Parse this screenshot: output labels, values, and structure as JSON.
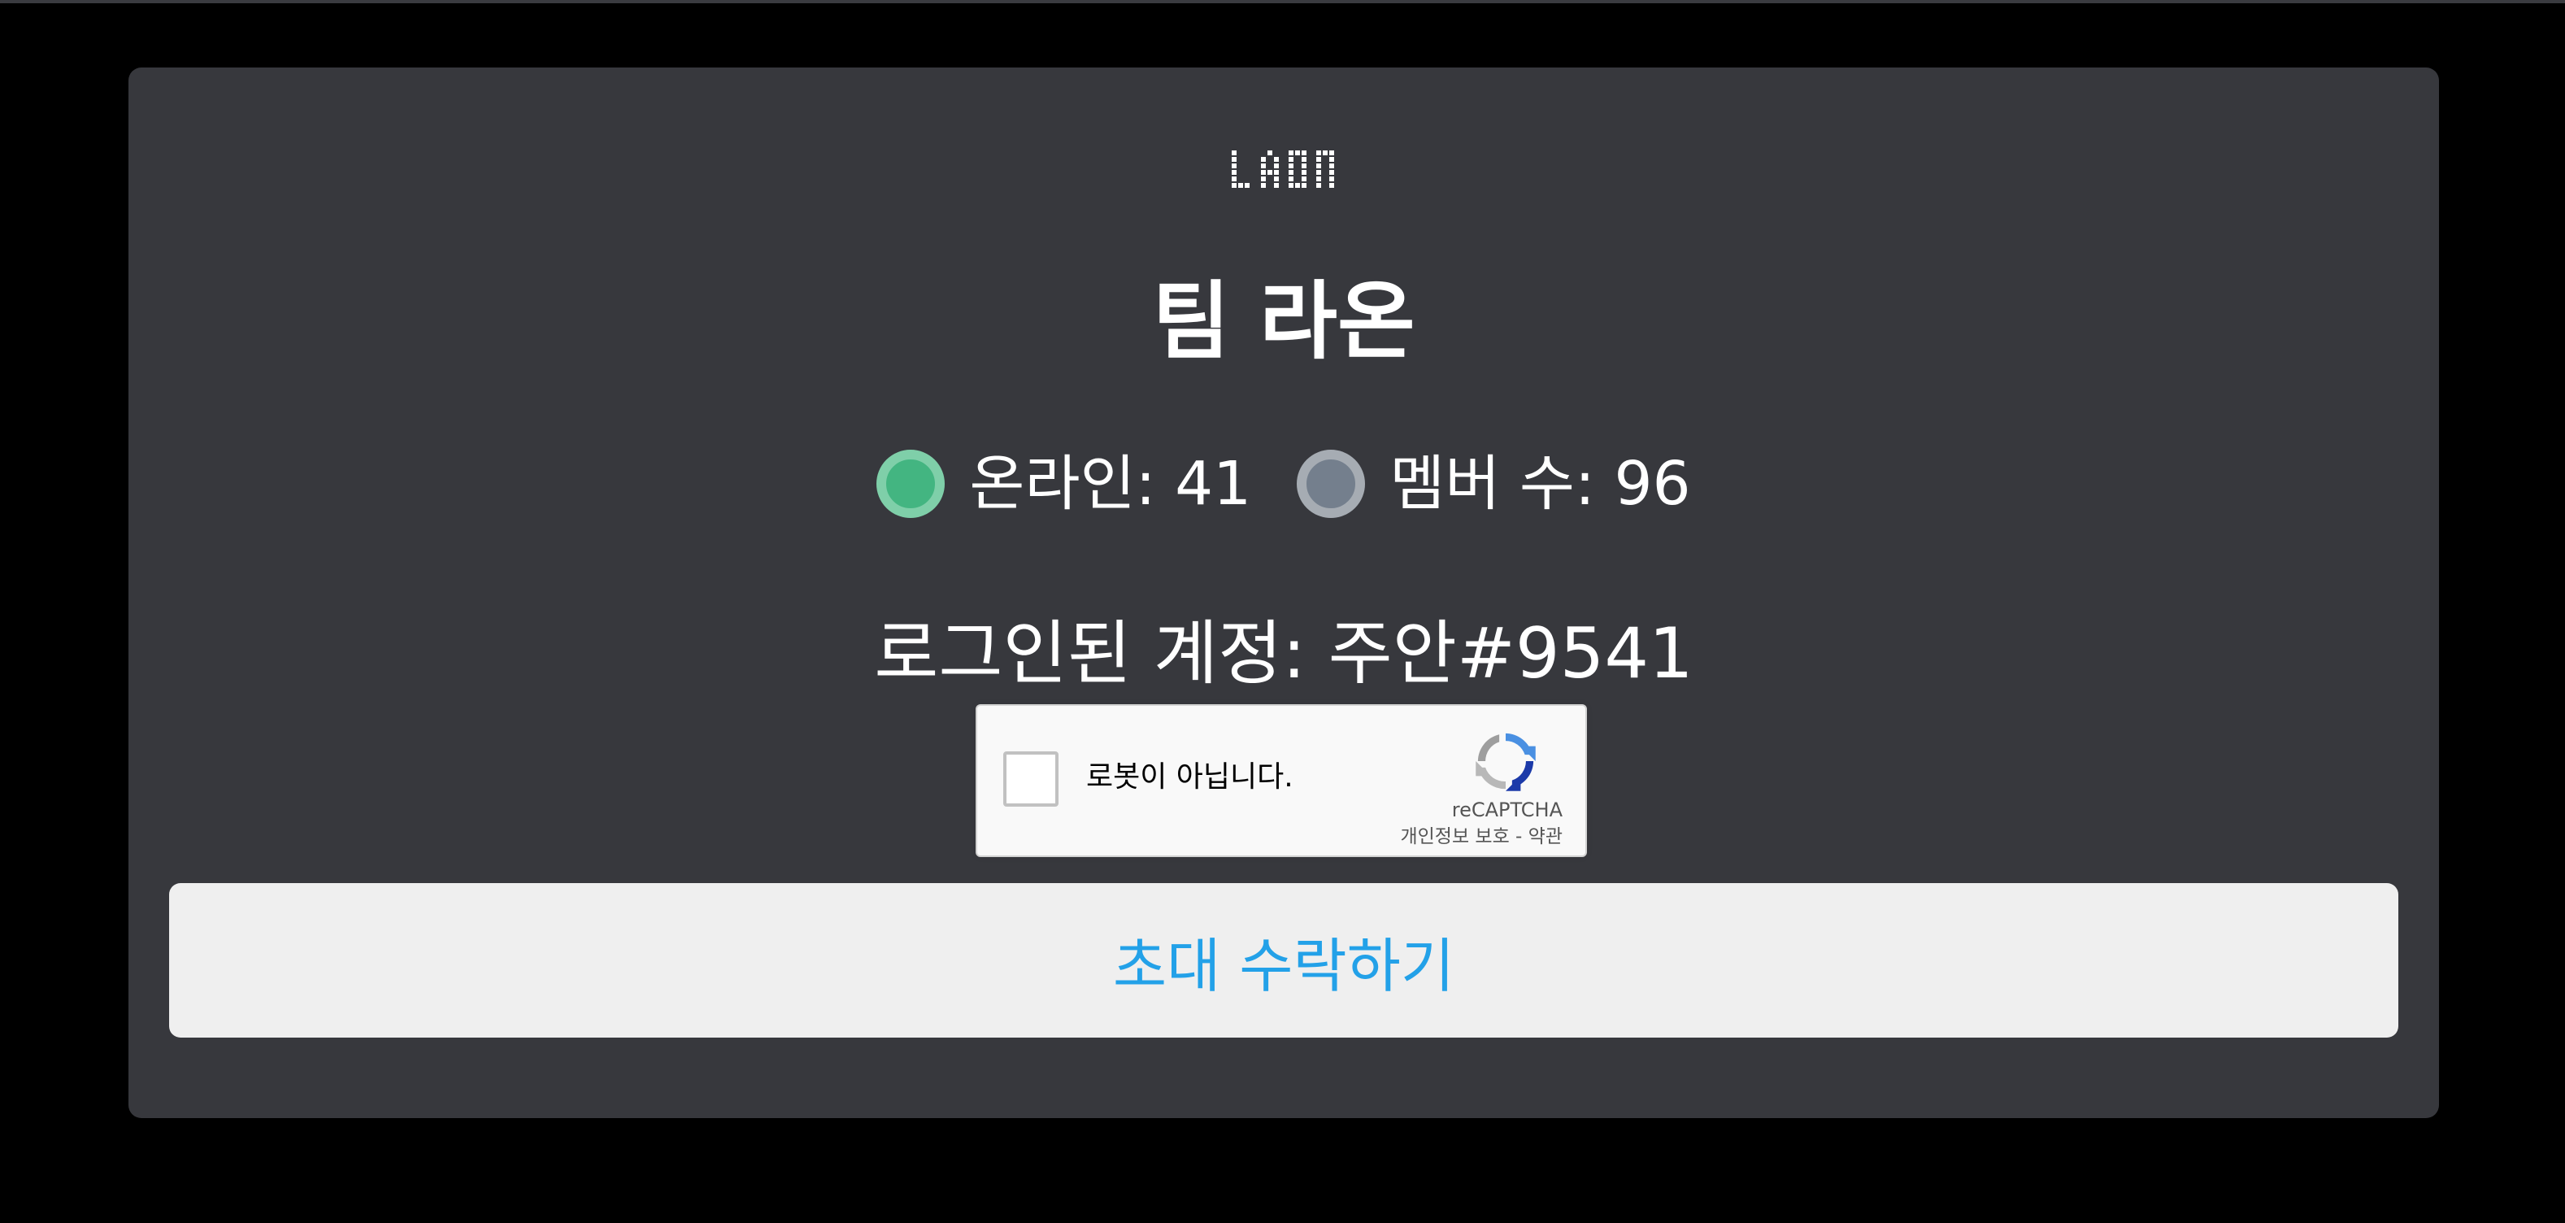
{
  "invite": {
    "logo_text": "LAON",
    "team_name": "팀 라온",
    "online_label": "온라인: 41",
    "members_label": "멤버 수: 96",
    "logged_in_account": "로그인된 계정: 주안#9541"
  },
  "recaptcha": {
    "checkbox_label": "로봇이 아닙니다.",
    "brand": "reCAPTCHA",
    "privacy_link": "개인정보 보호",
    "separator": " - ",
    "terms_link": "약관"
  },
  "accept_button": {
    "label": "초대 수락하기"
  },
  "colors": {
    "background": "#000000",
    "card": "#37383d",
    "online": "#43b581",
    "members": "#747f8d",
    "button_text": "#23a1e8",
    "button_bg": "#efefef"
  },
  "icons": {
    "online_status": "online-status-dot-icon",
    "member_status": "member-status-dot-icon",
    "recaptcha": "recaptcha-logo-icon"
  }
}
